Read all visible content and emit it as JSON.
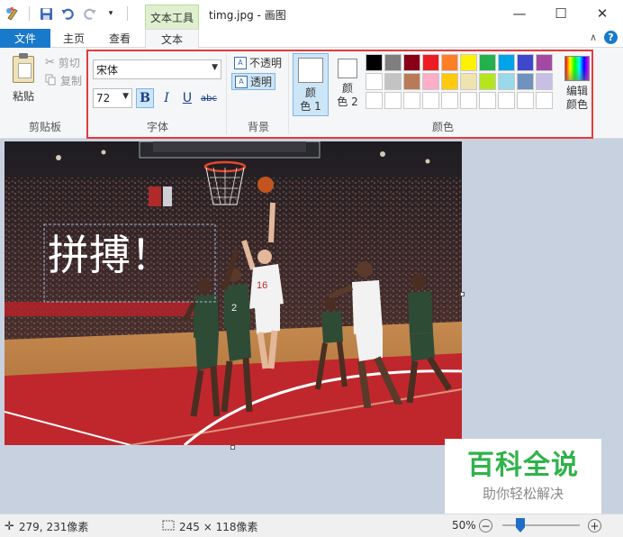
{
  "window": {
    "title": "timg.jpg - 画图",
    "context_tab_group": "文本工具",
    "controls": {
      "minimize": "—",
      "maximize": "☐",
      "close": "✕"
    }
  },
  "quick_access": {
    "items": [
      "paint-app-icon",
      "save-icon",
      "undo-icon",
      "redo-icon",
      "customize-dropdown-icon"
    ]
  },
  "tabs": {
    "file": "文件",
    "home": "主页",
    "view": "查看",
    "text": "文本",
    "collapse": "∧",
    "help": "?"
  },
  "ribbon": {
    "clipboard": {
      "paste": "粘贴",
      "cut": "剪切",
      "copy": "复制",
      "group_label": "剪贴板"
    },
    "font": {
      "family": "宋体",
      "size": "72",
      "bold": "B",
      "italic": "I",
      "underline": "U",
      "strikethrough": "abc",
      "bold_active": true,
      "group_label": "字体"
    },
    "background": {
      "opaque": "不透明",
      "transparent": "透明",
      "selected": "transparent",
      "group_label": "背景"
    },
    "colors": {
      "color1_line1": "颜",
      "color1_line2": "色 1",
      "color2_line1": "颜",
      "color2_line2": "色 2",
      "color1_value": "#ffffff",
      "color2_value": "#ffffff",
      "edit_line1": "编辑",
      "edit_line2": "颜色",
      "group_label": "颜色",
      "palette_row1": [
        "#000000",
        "#7f7f7f",
        "#880015",
        "#ed1c24",
        "#ff7f27",
        "#fff200",
        "#22b14c",
        "#00a2e8",
        "#3f48cc",
        "#a349a4"
      ],
      "palette_row2": [
        "#ffffff",
        "#c3c3c3",
        "#b97a57",
        "#ffaec9",
        "#ffc90e",
        "#efe4b0",
        "#b5e61d",
        "#99d9ea",
        "#7092be",
        "#c8bfe7"
      ],
      "palette_row3": [
        "#ffffff",
        "#ffffff",
        "#ffffff",
        "#ffffff",
        "#ffffff",
        "#ffffff",
        "#ffffff",
        "#ffffff",
        "#ffffff",
        "#ffffff"
      ]
    }
  },
  "canvas": {
    "overlay_text": "拼搏！",
    "jersey_numbers": [
      "16",
      "2"
    ]
  },
  "watermark": {
    "title": "百科全说",
    "subtitle": "助你轻松解决"
  },
  "statusbar": {
    "cursor_pos": "279, 231像素",
    "selection_size": "245 × 118像素",
    "zoom": "50%",
    "zoom_out": "−",
    "zoom_in": "+",
    "zoom_level_fraction": 0.5
  }
}
